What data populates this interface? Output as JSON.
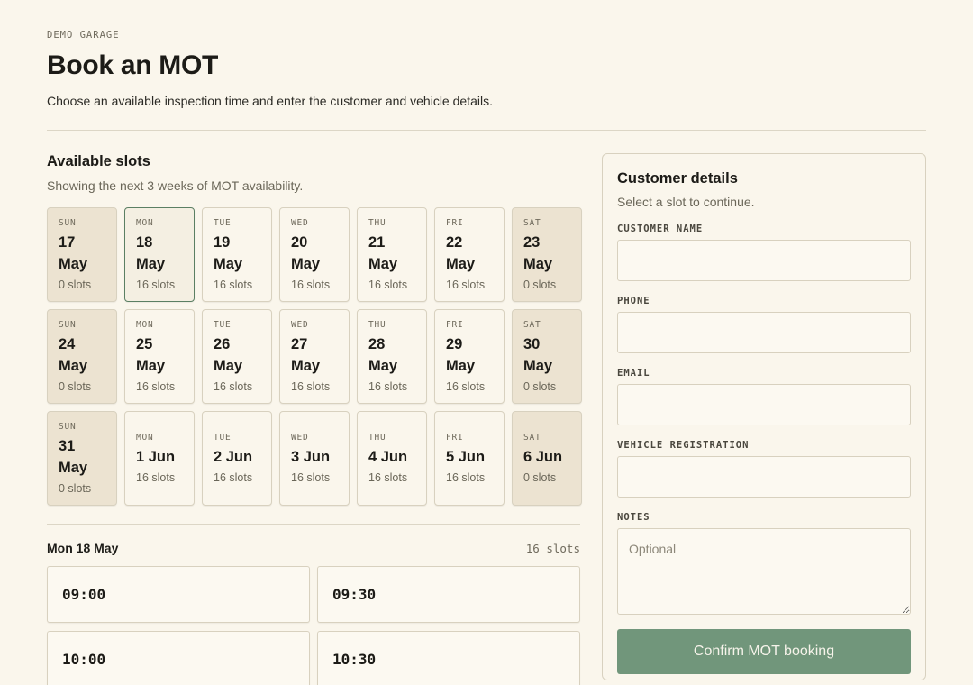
{
  "header": {
    "eyebrow": "DEMO GARAGE",
    "title": "Book an MOT",
    "subtitle": "Choose an available inspection time and enter the customer and vehicle details."
  },
  "availability": {
    "title": "Available slots",
    "subtitle": "Showing the next 3 weeks of MOT availability.",
    "days": [
      {
        "dow": "SUN",
        "date": "17 May",
        "slots": "0 slots",
        "state": "closed"
      },
      {
        "dow": "MON",
        "date": "18 May",
        "slots": "16 slots",
        "state": "selected"
      },
      {
        "dow": "TUE",
        "date": "19 May",
        "slots": "16 slots",
        "state": "open"
      },
      {
        "dow": "WED",
        "date": "20 May",
        "slots": "16 slots",
        "state": "open"
      },
      {
        "dow": "THU",
        "date": "21 May",
        "slots": "16 slots",
        "state": "open"
      },
      {
        "dow": "FRI",
        "date": "22 May",
        "slots": "16 slots",
        "state": "open"
      },
      {
        "dow": "SAT",
        "date": "23 May",
        "slots": "0 slots",
        "state": "closed"
      },
      {
        "dow": "SUN",
        "date": "24 May",
        "slots": "0 slots",
        "state": "closed"
      },
      {
        "dow": "MON",
        "date": "25 May",
        "slots": "16 slots",
        "state": "open"
      },
      {
        "dow": "TUE",
        "date": "26 May",
        "slots": "16 slots",
        "state": "open"
      },
      {
        "dow": "WED",
        "date": "27 May",
        "slots": "16 slots",
        "state": "open"
      },
      {
        "dow": "THU",
        "date": "28 May",
        "slots": "16 slots",
        "state": "open"
      },
      {
        "dow": "FRI",
        "date": "29 May",
        "slots": "16 slots",
        "state": "open"
      },
      {
        "dow": "SAT",
        "date": "30 May",
        "slots": "0 slots",
        "state": "closed"
      },
      {
        "dow": "SUN",
        "date": "31 May",
        "slots": "0 slots",
        "state": "closed"
      },
      {
        "dow": "MON",
        "date": "1 Jun",
        "slots": "16 slots",
        "state": "open"
      },
      {
        "dow": "TUE",
        "date": "2 Jun",
        "slots": "16 slots",
        "state": "open"
      },
      {
        "dow": "WED",
        "date": "3 Jun",
        "slots": "16 slots",
        "state": "open"
      },
      {
        "dow": "THU",
        "date": "4 Jun",
        "slots": "16 slots",
        "state": "open"
      },
      {
        "dow": "FRI",
        "date": "5 Jun",
        "slots": "16 slots",
        "state": "open"
      },
      {
        "dow": "SAT",
        "date": "6 Jun",
        "slots": "0 slots",
        "state": "closed"
      }
    ]
  },
  "selected_day": {
    "label": "Mon 18 May",
    "count": "16 slots",
    "times": [
      "09:00",
      "09:30",
      "10:00",
      "10:30"
    ]
  },
  "customer": {
    "title": "Customer details",
    "subtitle": "Select a slot to continue.",
    "fields": [
      {
        "label": "CUSTOMER NAME",
        "value": "",
        "placeholder": ""
      },
      {
        "label": "PHONE",
        "value": "",
        "placeholder": ""
      },
      {
        "label": "EMAIL",
        "value": "",
        "placeholder": ""
      },
      {
        "label": "VEHICLE REGISTRATION",
        "value": "",
        "placeholder": ""
      }
    ],
    "notes": {
      "label": "NOTES",
      "value": "",
      "placeholder": "Optional"
    },
    "confirm_label": "Confirm MOT booking"
  },
  "colors": {
    "background": "#faf6ec",
    "closed_day": "#ece3d1",
    "selected_border": "#5b7f63",
    "confirm_button": "#71967b"
  }
}
